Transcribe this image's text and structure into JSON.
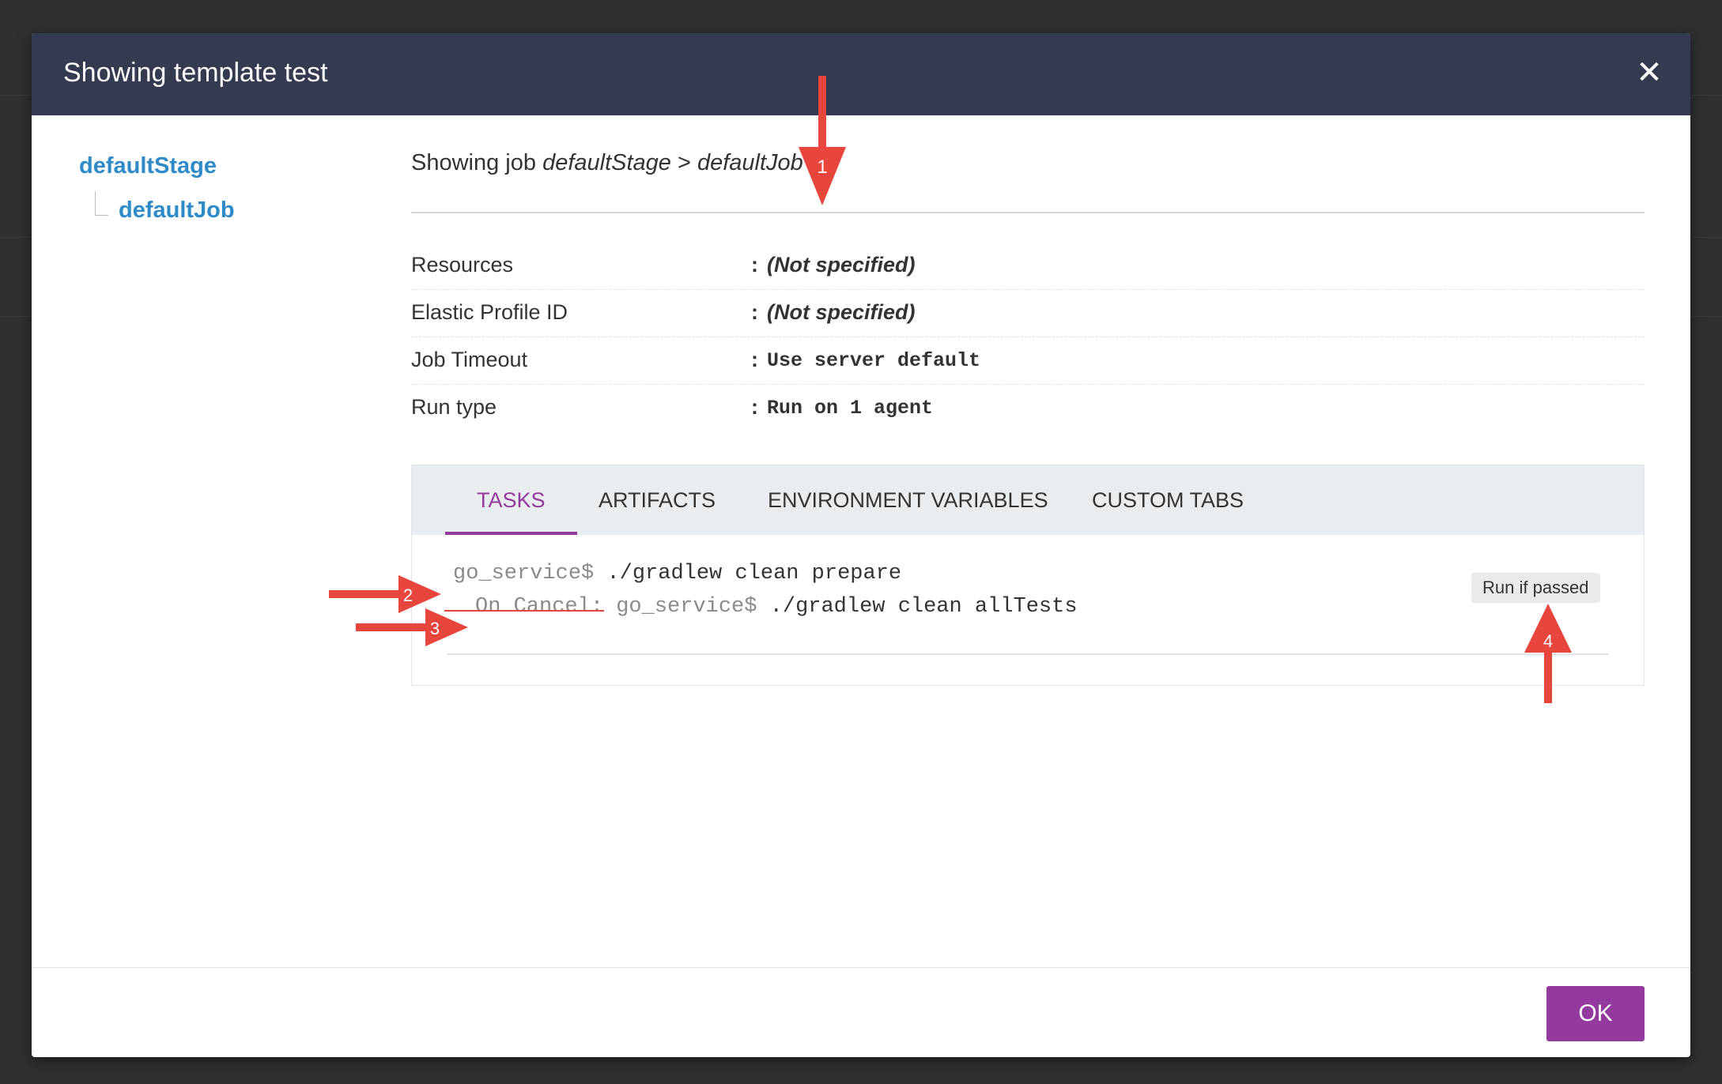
{
  "modal": {
    "title": "Showing template test",
    "close_icon": "close-icon",
    "ok_label": "OK"
  },
  "tree": {
    "stage": "defaultStage",
    "job": "defaultJob"
  },
  "heading": {
    "prefix": "Showing job",
    "stage": "defaultStage",
    "separator": ">",
    "job": "defaultJob"
  },
  "properties": [
    {
      "label": "Resources",
      "value": "(Not specified)"
    },
    {
      "label": "Elastic Profile ID",
      "value": "(Not specified)"
    },
    {
      "label": "Job Timeout",
      "value": "Use server default"
    },
    {
      "label": "Run type",
      "value": "Run on 1 agent"
    }
  ],
  "colon": ":",
  "tabs": [
    {
      "label": "TASKS",
      "active": true
    },
    {
      "label": "ARTIFACTS",
      "active": false
    },
    {
      "label": "ENVIRONMENT VARIABLES",
      "active": false
    },
    {
      "label": "CUSTOM TABS",
      "active": false
    }
  ],
  "task": {
    "prompt": "go_service$",
    "command": "./gradlew clean prepare",
    "on_cancel_label": "On Cancel:",
    "on_cancel_prompt": "go_service$",
    "on_cancel_command": "./gradlew clean allTests",
    "run_condition": "Run if passed"
  },
  "annotations": [
    "1",
    "2",
    "3",
    "4"
  ],
  "colors": {
    "header_bg": "#343a50",
    "link": "#2f8ac8",
    "accent": "#943a9e",
    "annotation": "#e8453c"
  }
}
